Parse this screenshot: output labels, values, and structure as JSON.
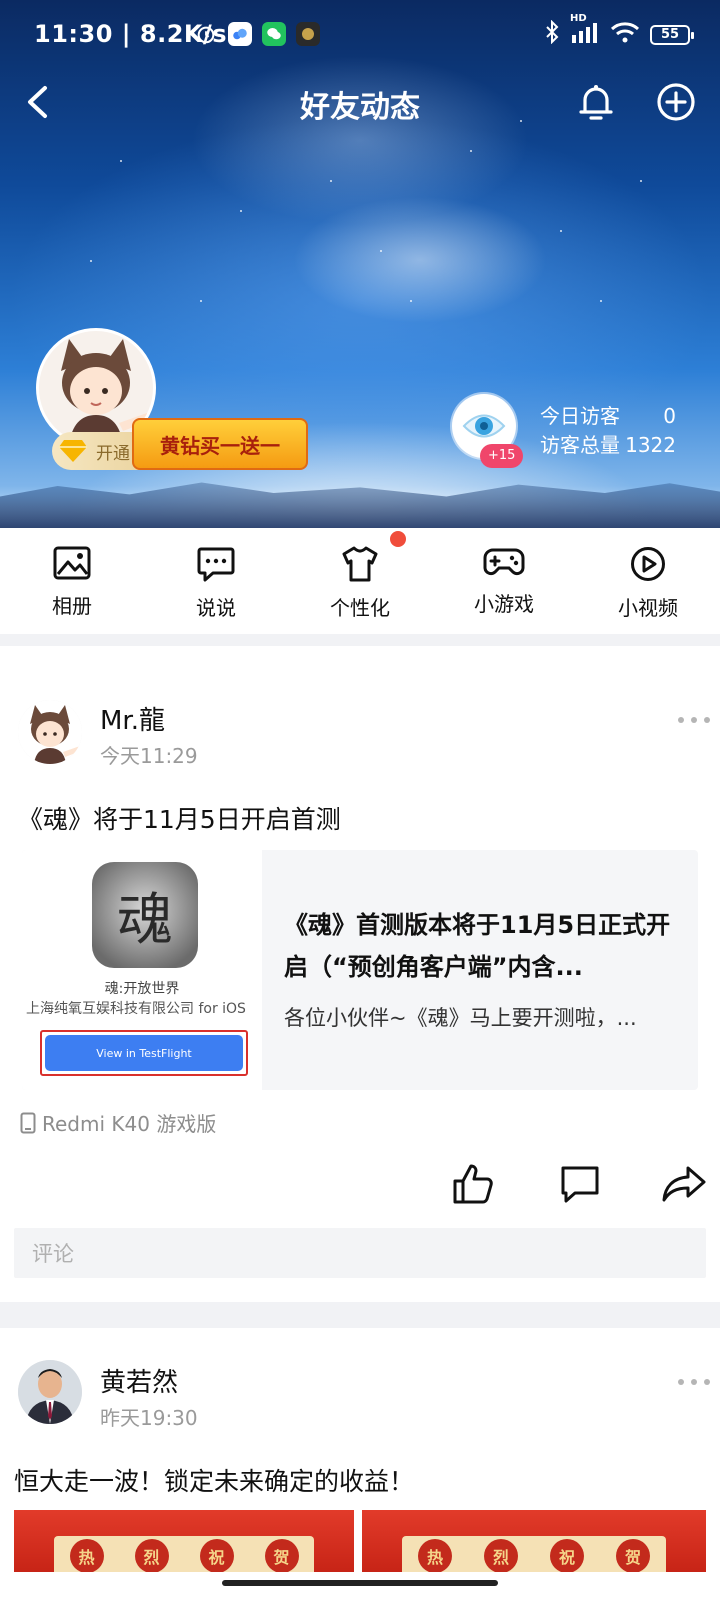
{
  "status_bar": {
    "time": "11:30",
    "speed": "8.2K/s",
    "network": "HD",
    "battery": "55"
  },
  "nav": {
    "title": "好友动态"
  },
  "profile": {
    "vip_label": "开通",
    "promo_text": "黄钻买一送一",
    "visitor_badge": "+15",
    "today_visitors_label": "今日访客",
    "today_visitors_value": "0",
    "total_visitors_label": "访客总量",
    "total_visitors_value": "1322"
  },
  "quick_menu": [
    {
      "label": "相册",
      "icon": "album-icon"
    },
    {
      "label": "说说",
      "icon": "chat-icon"
    },
    {
      "label": "个性化",
      "icon": "tshirt-icon"
    },
    {
      "label": "小游戏",
      "icon": "gamepad-icon"
    },
    {
      "label": "小视频",
      "icon": "play-icon"
    }
  ],
  "posts": [
    {
      "author": "Mr.龍",
      "time": "今天11:29",
      "text": "《魂》将于11月5日开启首测",
      "card": {
        "logo_char": "魂",
        "app_name": "魂:开放世界",
        "company": "上海纯氧互娱科技有限公司 for iOS",
        "button": "View in TestFlight",
        "title": "《魂》首测版本将于11月5日正式开启（“预创角客户端”内含...",
        "desc": "各位小伙伴~《魂》马上要开测啦，..."
      },
      "device": "Redmi K40 游戏版",
      "comment_placeholder": "评论"
    },
    {
      "author": "黄若然",
      "time": "昨天19:30",
      "text": "恒大走一波！锁定未来确定的收益！",
      "image_seals": [
        "热",
        "烈",
        "祝",
        "贺"
      ]
    }
  ]
}
